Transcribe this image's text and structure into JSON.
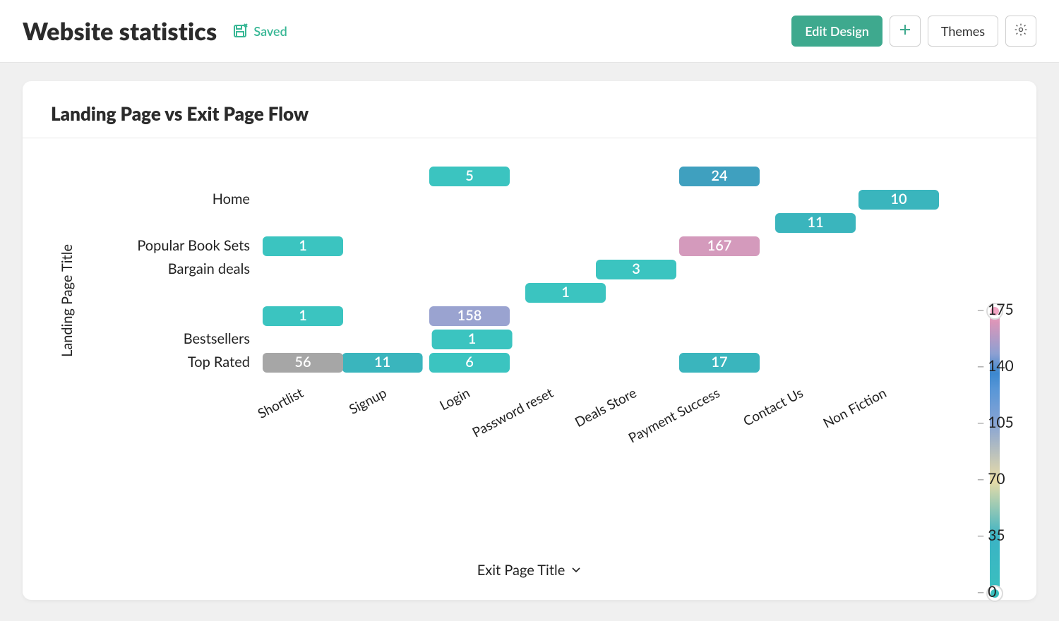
{
  "header": {
    "title": "Website statistics",
    "saved_label": "Saved",
    "edit_design": "Edit Design",
    "themes": "Themes"
  },
  "card": {
    "title": "Landing Page vs Exit Page Flow",
    "y_axis_title": "Landing Page Title",
    "x_axis_title": "Exit Page Title"
  },
  "legend_ticks": [
    175,
    140,
    105,
    70,
    35,
    0
  ],
  "chart_data": {
    "type": "heatmap",
    "xlabel": "Exit Page Title",
    "ylabel": "Landing Page Title",
    "x_categories": [
      "Shortlist",
      "Signup",
      "Login",
      "Password reset",
      "Deals Store",
      "Payment Success",
      "Contact Us",
      "Non Fiction"
    ],
    "y_categories": [
      "Home",
      "Popular Book Sets",
      "Bargain deals",
      "Bestsellers",
      "Top Rated"
    ],
    "y_sub_rows": {
      "Home": 2,
      "Popular Book Sets": 2,
      "Bargain deals": 1,
      "Bestsellers": 3,
      "Top Rated": 1
    },
    "color_scale": {
      "min": 0,
      "max": 175
    },
    "cells": [
      {
        "y": "Home",
        "sub": 0,
        "x": "Login",
        "value": 5
      },
      {
        "y": "Home",
        "sub": 0,
        "x": "Payment Success",
        "value": 24
      },
      {
        "y": "Home",
        "sub": 1,
        "x": "Non Fiction",
        "value": 10
      },
      {
        "y": "Popular Book Sets",
        "sub": 0,
        "x": "Contact Us",
        "value": 11
      },
      {
        "y": "Popular Book Sets",
        "sub": 1,
        "x": "Shortlist",
        "value": 1
      },
      {
        "y": "Popular Book Sets",
        "sub": 1,
        "x": "Payment Success",
        "value": 167
      },
      {
        "y": "Bargain deals",
        "sub": 0,
        "x": "Deals Store",
        "value": 3
      },
      {
        "y": "Bestsellers",
        "sub": 0,
        "x": "Password reset",
        "value": 1
      },
      {
        "y": "Bestsellers",
        "sub": 1,
        "x": "Shortlist",
        "value": 1
      },
      {
        "y": "Bestsellers",
        "sub": 1,
        "x": "Login",
        "value": 158
      },
      {
        "y": "Bestsellers",
        "sub": 2,
        "x": "Login",
        "value": 1
      },
      {
        "y": "Top Rated",
        "sub": 0,
        "x": "Signup",
        "value": 11
      },
      {
        "y": "Top Rated",
        "sub": 0,
        "x": "Shortlist",
        "value": 56
      },
      {
        "y": "Top Rated",
        "sub": 0,
        "x": "Login",
        "value": 6
      },
      {
        "y": "Top Rated",
        "sub": 0,
        "x": "Payment Success",
        "value": 17
      }
    ]
  }
}
